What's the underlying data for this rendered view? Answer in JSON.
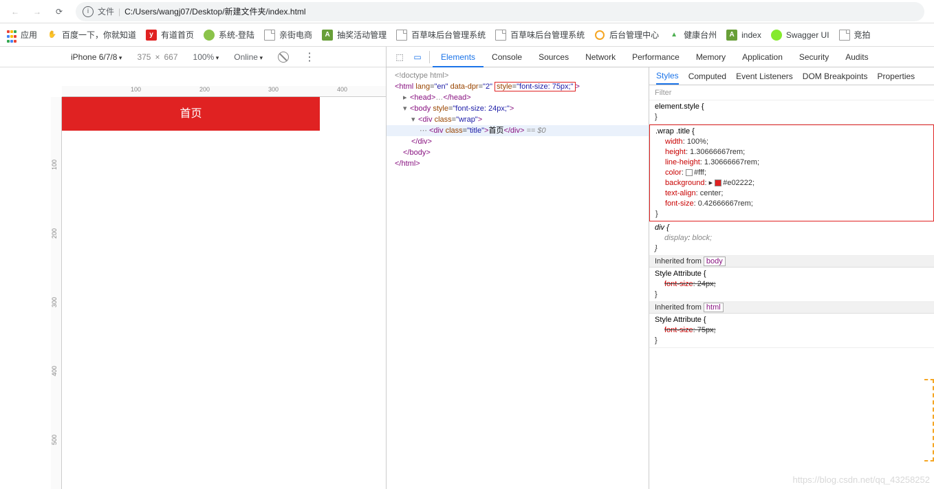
{
  "browser": {
    "url_info_label": "文件",
    "url_path": "C:/Users/wangj07/Desktop/新建文件夹/index.html"
  },
  "bookmarks": {
    "apps": "应用",
    "items": [
      "百度一下，你就知道",
      "有道首页",
      "系统-登陆",
      "亲街电商",
      "抽奖活动管理",
      "百草味后台管理系统",
      "百草味后台管理系统",
      "后台管理中心",
      "健康台州",
      "index",
      "Swagger UI",
      "竞拍"
    ]
  },
  "device": {
    "name": "iPhone 6/7/8",
    "width": "375",
    "height": "667",
    "zoom": "100%",
    "throttle": "Online"
  },
  "ruler_h": [
    "100",
    "200",
    "300",
    "400",
    "500"
  ],
  "ruler_v": [
    "100",
    "200",
    "300",
    "400",
    "500"
  ],
  "page": {
    "title_text": "首页"
  },
  "devtools": {
    "tabs": [
      "Elements",
      "Console",
      "Sources",
      "Network",
      "Performance",
      "Memory",
      "Application",
      "Security",
      "Audits"
    ],
    "styles_tabs": [
      "Styles",
      "Computed",
      "Event Listeners",
      "DOM Breakpoints",
      "Properties"
    ],
    "filter_placeholder": "Filter"
  },
  "dom": {
    "doctype": "<!doctype html>",
    "html_open_pre": "<html lang=\"en\" data-dpr=\"2\"",
    "html_style_attr": "style",
    "html_style_val": "font-size: 75px;",
    "head": "<head>…</head>",
    "body_open": "<body style=\"font-size: 24px;\">",
    "wrap_open": "<div class=\"wrap\">",
    "title_div_open": "<div class=\"",
    "title_class": "title",
    "title_div_mid": "\">",
    "title_text": "首页",
    "title_div_close": "</div>",
    "sel_marker": " == $0",
    "div_close": "</div>",
    "body_close": "</body>",
    "html_close": "</html>"
  },
  "styles": {
    "element_style": "element.style {",
    "rule1_selector": ".wrap .title {",
    "rule1": {
      "width": "width",
      "width_v": "100%;",
      "height": "height",
      "height_v": "1.30666667rem;",
      "lh": "line-height",
      "lh_v": "1.30666667rem;",
      "color": "color",
      "color_v": "#fff;",
      "bg": "background",
      "bg_v": "#e02222;",
      "ta": "text-align",
      "ta_v": "center;",
      "fs": "font-size",
      "fs_v": "0.42666667rem;"
    },
    "rule2_selector": "div {",
    "rule2": {
      "display": "display",
      "display_v": "block;"
    },
    "inherit_body_label": "Inherited from ",
    "inherit_body_tag": "body",
    "style_attr_label": "Style Attribute {",
    "body_fs": "font-size",
    "body_fs_v": "24px;",
    "inherit_html_tag": "html",
    "html_fs": "font-size",
    "html_fs_v": "75px;"
  },
  "watermark": "https://blog.csdn.net/qq_43258252"
}
